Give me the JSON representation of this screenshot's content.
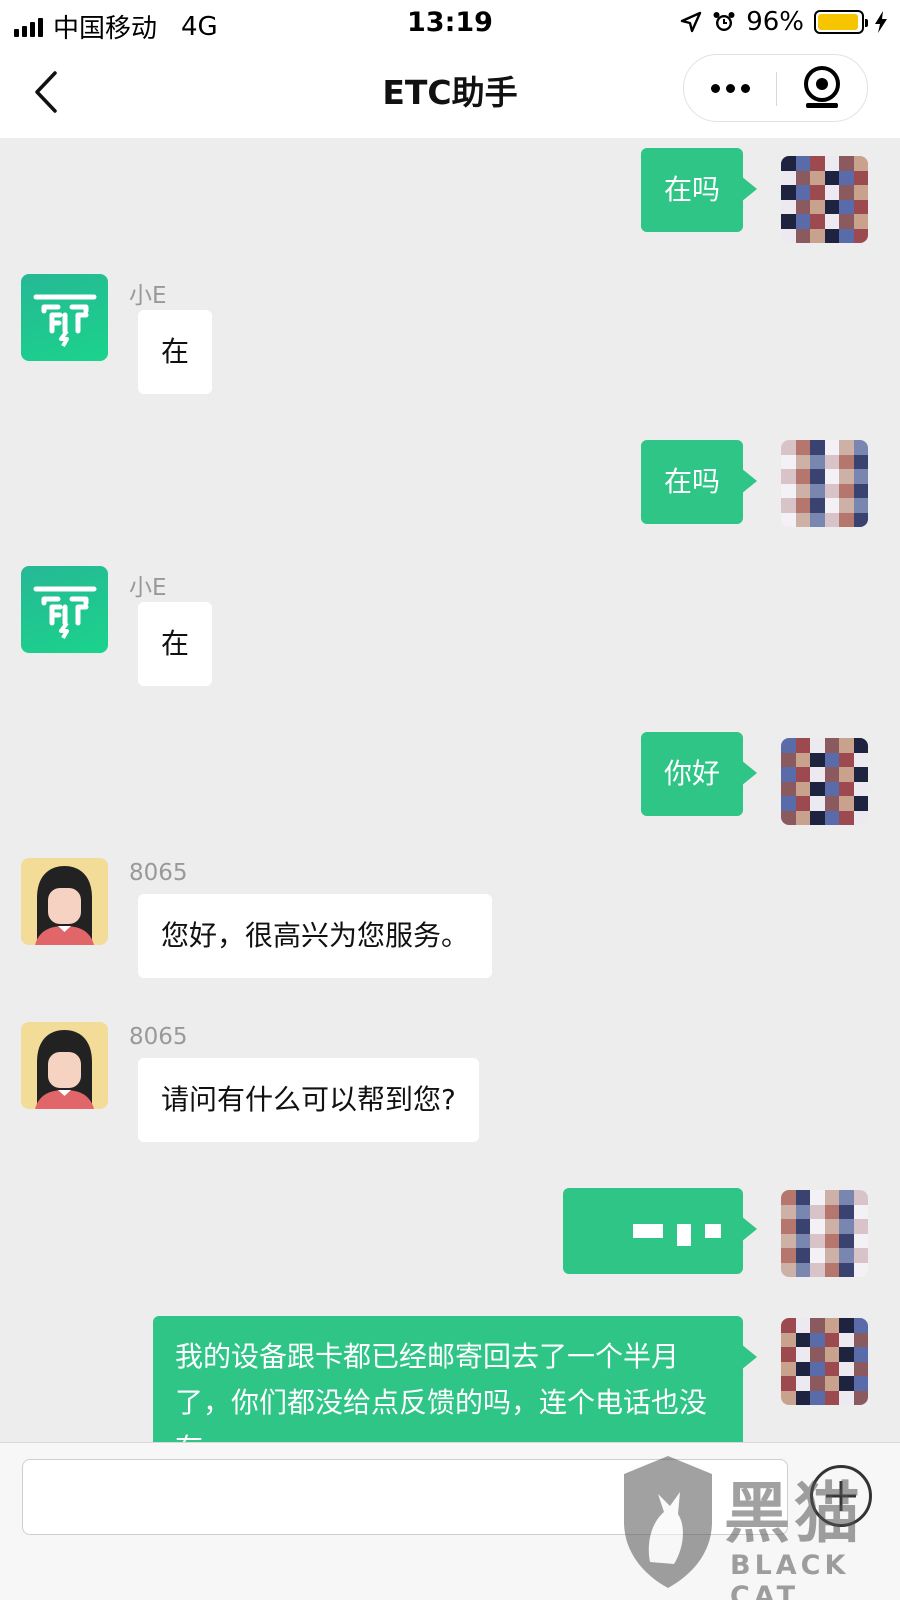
{
  "status_bar": {
    "carrier": "中国移动",
    "network": "4G",
    "time": "13:19",
    "battery_percent": "96%",
    "battery_level": 0.96,
    "icons": [
      "signal-icon",
      "location-icon",
      "alarm-icon",
      "battery-icon",
      "charging-icon"
    ]
  },
  "nav": {
    "title": "ETC助手",
    "back_icon": "chevron-left-icon",
    "more_icon": "more-dots-icon",
    "close_icon": "target-close-icon"
  },
  "messages": [
    {
      "side": "out",
      "text": "在吗"
    },
    {
      "side": "in",
      "sender": "小E",
      "avatar": "etc-logo",
      "text": "在"
    },
    {
      "side": "out",
      "text": "在吗"
    },
    {
      "side": "in",
      "sender": "小E",
      "avatar": "etc-logo",
      "text": "在"
    },
    {
      "side": "out",
      "text": "你好"
    },
    {
      "side": "in",
      "sender": "8065",
      "avatar": "agent-girl",
      "text": "您好，很高兴为您服务。"
    },
    {
      "side": "in",
      "sender": "8065",
      "avatar": "agent-girl",
      "text": "请问有什么可以帮到您?"
    },
    {
      "side": "out",
      "text": "",
      "garbled": true
    },
    {
      "side": "out",
      "text": "我的设备跟卡都已经邮寄回去了一个半月了，你们都没给点反馈的吗，连个电话也没有"
    }
  ],
  "input": {
    "value": "",
    "plus_icon": "plus-icon"
  },
  "watermark": {
    "cn": "黑猫",
    "en": "BLACK CAT"
  },
  "colors": {
    "bubble_out": "#2ec586",
    "bubble_in": "#ffffff",
    "background": "#ededed",
    "logo": "#1fc592",
    "battery": "#f7c500"
  }
}
